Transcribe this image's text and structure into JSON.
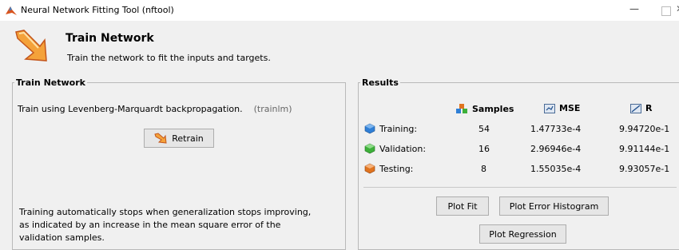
{
  "window": {
    "title": "Neural Network Fitting Tool (nftool)"
  },
  "header": {
    "title": "Train Network",
    "subtitle": "Train the network to fit the inputs and targets."
  },
  "train_panel": {
    "legend": "Train Network",
    "description": "Train using Levenberg-Marquardt backpropagation.",
    "function_name": "(trainlm)",
    "retrain_label": "Retrain",
    "note": "Training automatically stops when generalization stops improving, as indicated by an increase in the mean square error of the validation samples."
  },
  "results_panel": {
    "legend": "Results",
    "columns": {
      "samples": "Samples",
      "mse": "MSE",
      "r": "R"
    },
    "rows": [
      {
        "label": "Training:",
        "samples": "54",
        "mse": "1.47733e-4",
        "r": "9.94720e-1",
        "color": "#2f7fd6"
      },
      {
        "label": "Validation:",
        "samples": "16",
        "mse": "2.96946e-4",
        "r": "9.91144e-1",
        "color": "#3db03a"
      },
      {
        "label": "Testing:",
        "samples": "8",
        "mse": "1.55035e-4",
        "r": "9.93057e-1",
        "color": "#e0741f"
      }
    ],
    "buttons": {
      "plot_fit": "Plot Fit",
      "plot_error_histogram": "Plot Error Histogram",
      "plot_regression": "Plot Regression"
    }
  }
}
